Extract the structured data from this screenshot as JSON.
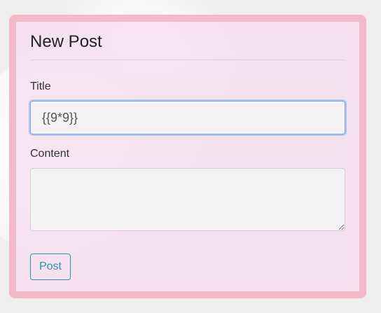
{
  "form": {
    "heading": "New Post",
    "title_label": "Title",
    "title_value": "{{9*9}}",
    "content_label": "Content",
    "content_value": "",
    "post_button_label": "Post"
  },
  "colors": {
    "frame_border": "#f5b8c9",
    "panel_background": "#f7daf0",
    "button_accent": "#2a94b0",
    "focus_ring": "#66a0eb"
  }
}
